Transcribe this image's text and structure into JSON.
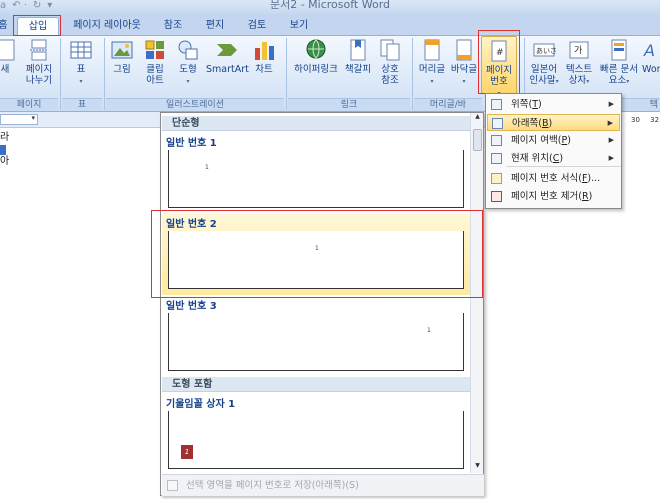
{
  "window": {
    "title": "문서2 - Microsoft Word"
  },
  "tabs": [
    {
      "label": "홈"
    },
    {
      "label": "삽입"
    },
    {
      "label": "페이지 레이아웃"
    },
    {
      "label": "참조"
    },
    {
      "label": "편지"
    },
    {
      "label": "검토"
    },
    {
      "label": "보기"
    }
  ],
  "ribbon": {
    "buttons": {
      "new_page": "새",
      "page_break": "페이지 나누기",
      "table": "표",
      "picture": "그림",
      "clipart": "클립 아트",
      "shapes": "도형",
      "smartart": "SmartArt",
      "chart": "차트",
      "hyperlink": "하이퍼링크",
      "bookmark": "책갈피",
      "crossref": "상호 참조",
      "header": "머리글",
      "footer": "바닥글",
      "page_number": "페이지 번호",
      "wordart": "일본어 인사말",
      "textbox": "텍스트 상자",
      "quickparts": "빠른 문서 요소",
      "wordart2": "Wor"
    },
    "groups": {
      "pages": "페이지",
      "table": "표",
      "illustrations": "일러스트레이션",
      "links": "링크",
      "header_footer": "머리글/바",
      "text": "텍"
    }
  },
  "ruler": {
    "ticks": [
      "30",
      "32"
    ]
  },
  "document": {
    "left_text": [
      "라",
      "아"
    ]
  },
  "gallery": {
    "section_simple": "단순형",
    "section_shapes": "도형 포함",
    "items": [
      {
        "title": "일반 번호 1",
        "num": "1"
      },
      {
        "title": "일반 번호 2",
        "num": "1"
      },
      {
        "title": "일반 번호 3",
        "num": "1"
      },
      {
        "title": "기울임꼴 상자 1",
        "num": "1"
      }
    ],
    "footer": "선택 영역을 페이지 번호로 저장(아래쪽)(S)"
  },
  "menu": {
    "items": [
      {
        "label": "위쪽",
        "key": "T",
        "submenu": true
      },
      {
        "label": "아래쪽",
        "key": "B",
        "submenu": true
      },
      {
        "label": "페이지 여백",
        "key": "P",
        "submenu": true
      },
      {
        "label": "현재 위치",
        "key": "C",
        "submenu": true
      },
      {
        "label": "페이지 번호 서식",
        "key": "F",
        "suffix": "...",
        "submenu": false
      },
      {
        "label": "페이지 번호 제거",
        "key": "R",
        "submenu": false
      }
    ]
  },
  "colors": {
    "accent": "#15428b",
    "highlight": "#ffd56b",
    "annotation": "#e03030"
  }
}
